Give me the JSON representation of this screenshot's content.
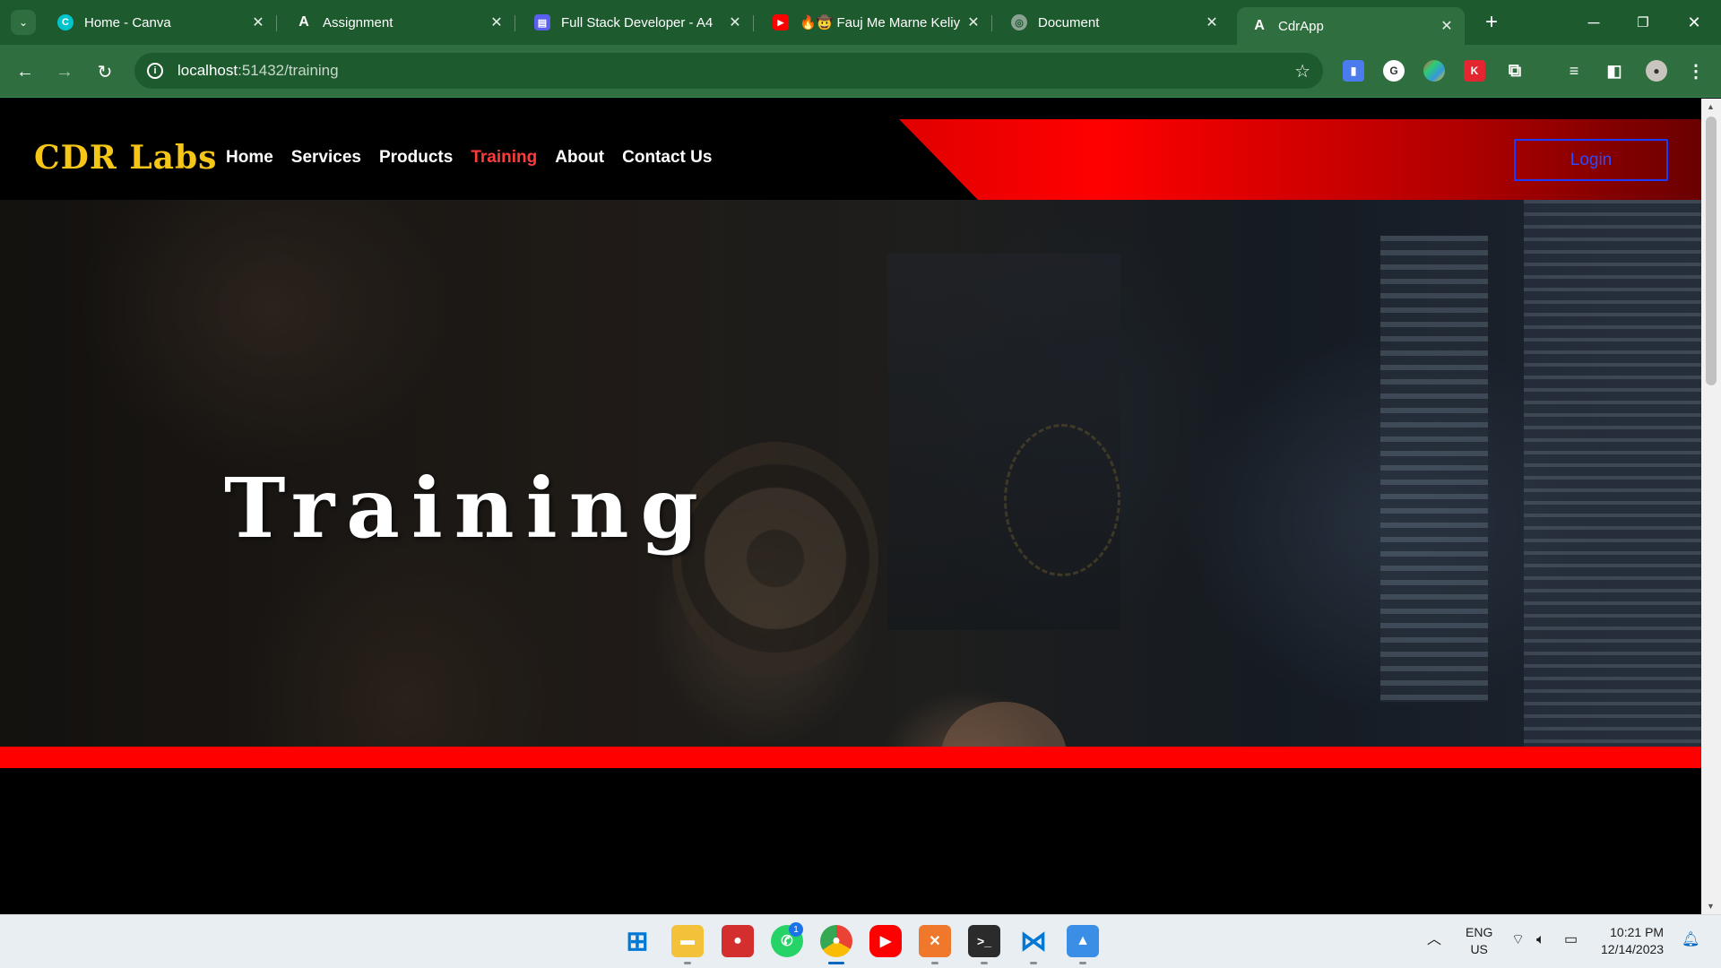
{
  "browser": {
    "tabs": [
      {
        "title": "Home - Canva",
        "icon": "canva-icon",
        "color": "#00c4cc"
      },
      {
        "title": "Assignment",
        "icon": "angular-icon",
        "color": "#1d5a2e"
      },
      {
        "title": "Full Stack Developer - A4",
        "icon": "doc-icon",
        "color": "#5a5ff0"
      },
      {
        "title": "🔥🤠 Fauj Me Marne Keliy",
        "icon": "youtube-icon",
        "color": "#ff0000"
      },
      {
        "title": "Document",
        "icon": "globe-icon",
        "color": "#8aa292"
      },
      {
        "title": "CdrApp",
        "icon": "angular-icon",
        "color": "#1d5a2e"
      }
    ],
    "active_tab_index": 5,
    "url_host": "localhost",
    "url_rest": ":51432/training"
  },
  "site": {
    "brand": "CDR Labs",
    "nav": [
      {
        "label": "Home",
        "active": false
      },
      {
        "label": "Services",
        "active": false
      },
      {
        "label": "Products",
        "active": false
      },
      {
        "label": "Training",
        "active": true
      },
      {
        "label": "About",
        "active": false
      },
      {
        "label": "Contact Us",
        "active": false
      }
    ],
    "login_label": "Login",
    "hero_title": "Training",
    "colors": {
      "brand": "#f5c518",
      "accent_red": "#ff0000",
      "active_nav": "#ff3b3b",
      "login_border": "#1a3dff"
    }
  },
  "taskbar": {
    "whatsapp_badge": "1",
    "language_top": "ENG",
    "language_bottom": "US",
    "time": "10:21 PM",
    "date": "12/14/2023"
  }
}
